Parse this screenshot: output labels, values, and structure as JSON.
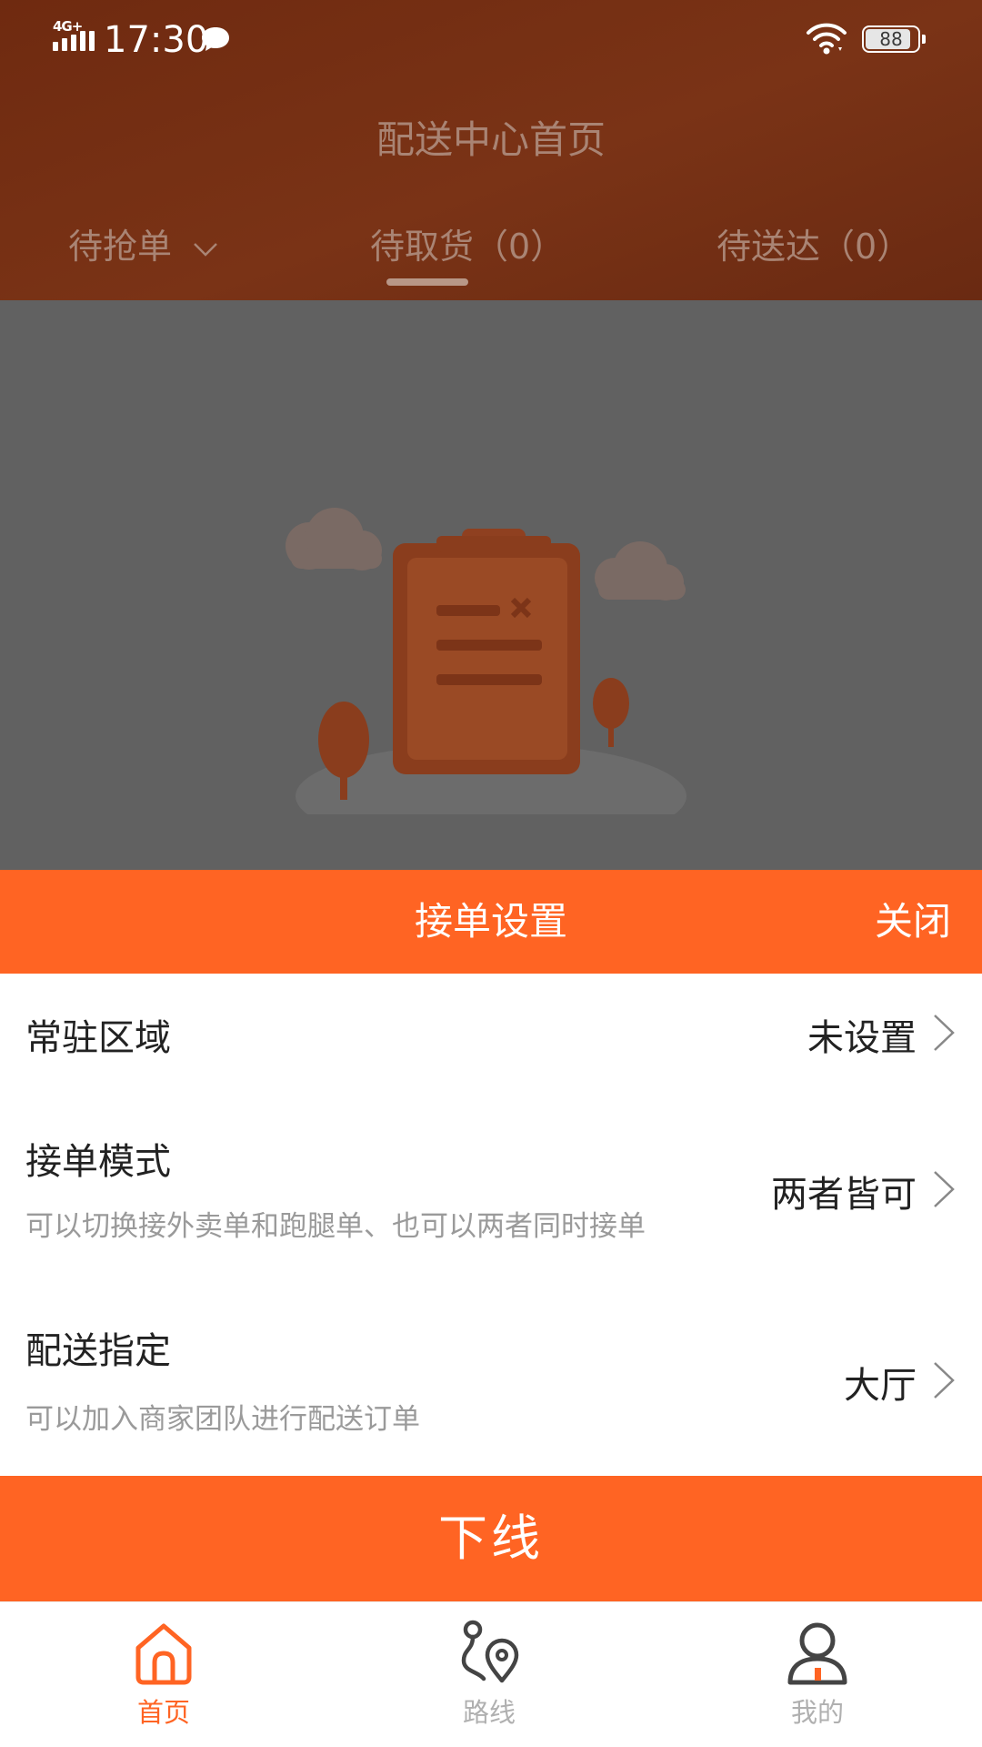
{
  "status_bar": {
    "network": "4G+",
    "time": "17:30",
    "battery": "88",
    "battery_fraction": 0.88
  },
  "header": {
    "title": "配送中心首页",
    "tabs": [
      {
        "label": "待抢单"
      },
      {
        "label": "待取货（0）"
      },
      {
        "label": "待送达（0）"
      }
    ]
  },
  "sheet": {
    "title": "接单设置",
    "close_label": "关闭",
    "rows": [
      {
        "title": "常驻区域",
        "value": "未设置",
        "desc": ""
      },
      {
        "title": "接单模式",
        "value": "两者皆可",
        "desc": "可以切换接外卖单和跑腿单、也可以两者同时接单"
      },
      {
        "title": "配送指定",
        "value": "大厅",
        "desc": "可以加入商家团队进行配送订单"
      }
    ],
    "offline_label": "下线"
  },
  "bottom_nav": {
    "items": [
      {
        "label": "首页",
        "icon": "home-icon",
        "active": true
      },
      {
        "label": "路线",
        "icon": "route-icon",
        "active": false
      },
      {
        "label": "我的",
        "icon": "profile-icon",
        "active": false
      }
    ]
  },
  "colors": {
    "accent": "#ff6423",
    "header_dim": "#6f2a10",
    "overlay": "#616161"
  }
}
